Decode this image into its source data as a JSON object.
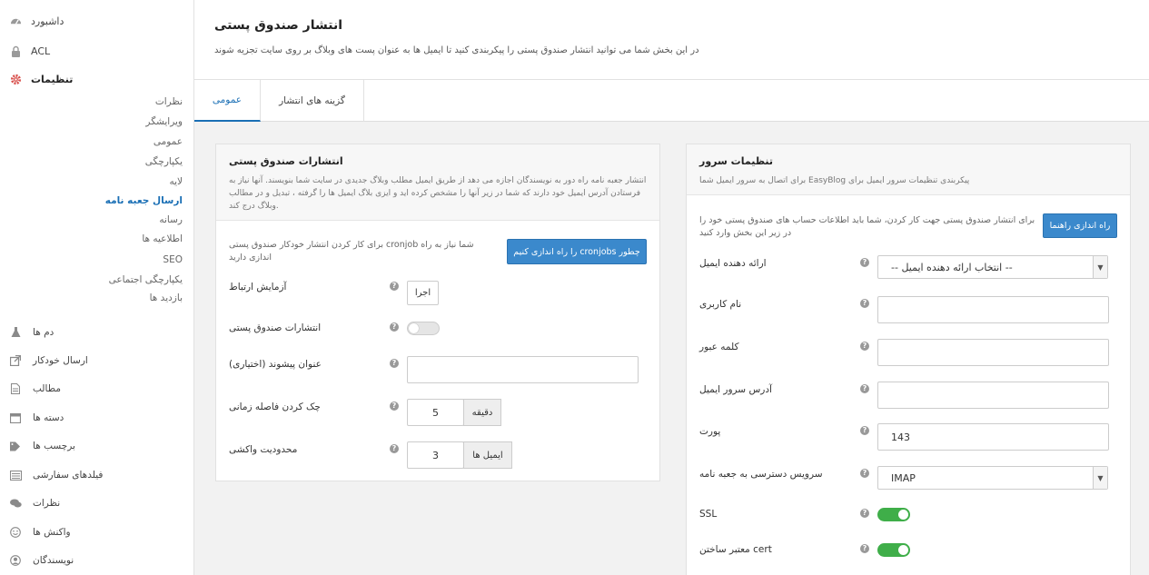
{
  "sidebar": {
    "top_items": [
      {
        "label": "داشبورد",
        "icon": "dashboard-icon"
      },
      {
        "label": "ACL",
        "icon": "lock-icon"
      },
      {
        "label": "تنظیمات",
        "icon": "gear-icon"
      }
    ],
    "sub_items": [
      "نظرات",
      "ویرایشگر",
      "عمومی",
      "یکپارچگی",
      "لایه",
      "ارسال جعبه نامه",
      "رسانه",
      "اطلاعیه ها",
      "SEO",
      "یکپارچگی اجتماعی",
      "بازدید ها"
    ],
    "bottom_items": [
      {
        "label": "دم ها",
        "icon": "flask-icon"
      },
      {
        "label": "ارسال خودکار",
        "icon": "share-icon"
      },
      {
        "label": "مطالب",
        "icon": "document-icon"
      },
      {
        "label": "دسته ها",
        "icon": "folder-icon"
      },
      {
        "label": "برچسب ها",
        "icon": "tag-icon"
      },
      {
        "label": "فیلدهای سفارشی",
        "icon": "form-icon"
      },
      {
        "label": "نظرات",
        "icon": "comments-icon"
      },
      {
        "label": "واکنش ها",
        "icon": "smile-icon"
      },
      {
        "label": "نویسندگان",
        "icon": "user-icon"
      }
    ]
  },
  "header": {
    "title": "انتشار صندوق پستی",
    "description": "در این بخش شما می توانید انتشار صندوق پستی را پیکربندی کنید تا ایمیل ها به عنوان پست های وبلاگ بر روی سایت تجزیه شوند"
  },
  "tabs": [
    {
      "label": "عمومی"
    },
    {
      "label": "گزینه های انتشار"
    }
  ],
  "left_panel": {
    "title": "انتشارات صندوق پستی",
    "description": "انتشار جعبه نامه راه دور به نویسندگان اجازه می دهد از طریق ایمیل مطلب وبلاگ جدیدی در سایت شما بنویسند. آنها نیاز به فرستادن آدرس ایمیل خود دارند که شما در زیر آنها را مشخص کرده اید و ایزی بلاگ ایمیل ها را گرفته ، تبدیل و در مطالب وبلاگ درج کند.",
    "cron_note": "برای کار کردن انتشار خودکار صندوق پستی cronjob شما نیاز به راه اندازی دارید",
    "cron_button": "را راه اندازی کنیم cronjobs چطور",
    "test_label": "آزمایش ارتباط",
    "test_button": "اجرا",
    "publish_label": "انتشارات صندوق پستی",
    "publish_on": false,
    "prefix_label": "عنوان پیشوند (اختیاری)",
    "prefix_value": "",
    "interval_label": "چک کردن فاصله زمانی",
    "interval_value": "5",
    "interval_unit": "دقیقه",
    "limit_label": "محدودیت واکشی",
    "limit_value": "3",
    "limit_unit": "ایمیل ها"
  },
  "right_panel": {
    "title": "تنظیمات سرور",
    "description": "برای اتصال به سرور ایمیل شما EasyBlog پیکربندی تنظیمات سرور ایمیل برای",
    "setup_note": "برای انتشار صندوق پستی جهت کار کردن، شما باید اطلاعات حساب های صندوق پستی خود را در زیر این بخش وارد کنید",
    "setup_button": "راه اندازی راهنما",
    "provider_label": "ارائه دهنده ایمیل",
    "provider_value": "-- انتخاب ارائه دهنده ایمیل --",
    "username_label": "نام کاربری",
    "username_value": "",
    "password_label": "کلمه عبور",
    "password_value": "",
    "server_label": "آدرس سرور ایمیل",
    "server_value": "",
    "port_label": "پورت",
    "port_value": "143",
    "service_label": "سرویس دسترسی به جعبه نامه",
    "service_value": "IMAP",
    "ssl_label": "SSL",
    "ssl_on": true,
    "cert_label": "معتبر ساختن cert",
    "cert_on": true
  },
  "colors": {
    "accent": "#1a6fb5",
    "button": "#3b89cc",
    "toggle_on": "#3fae49"
  }
}
